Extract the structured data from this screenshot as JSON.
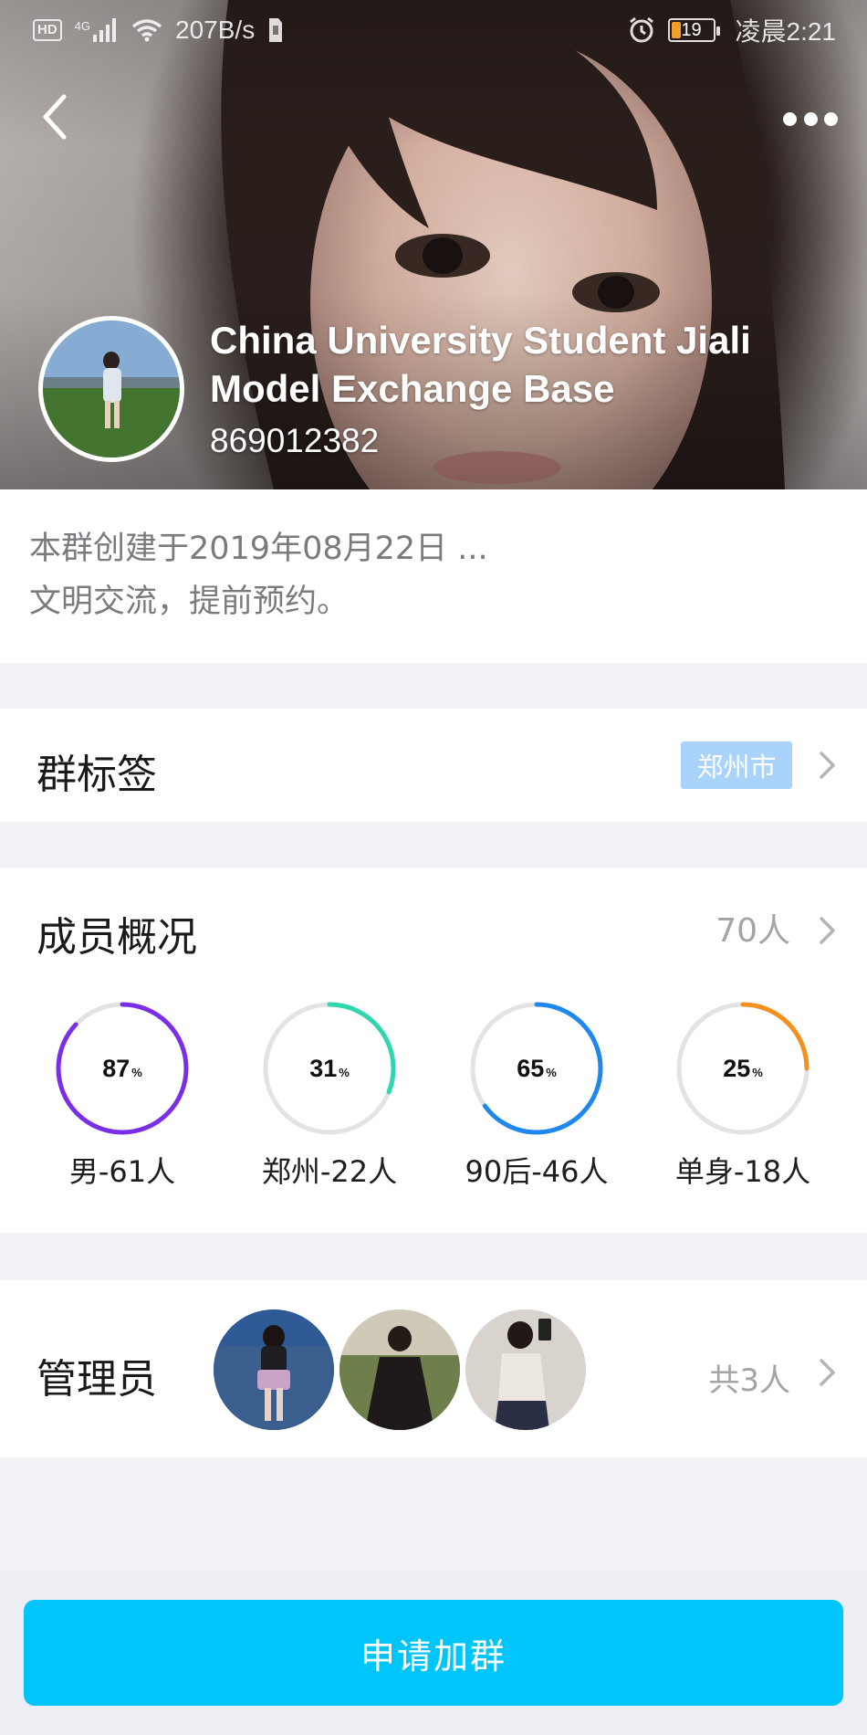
{
  "status_bar": {
    "network_badge": "HD",
    "network_type": "4G",
    "speed": "207B/s",
    "battery_level": "19",
    "time": "凌晨2:21",
    "battery_color": "#f3a02b"
  },
  "header": {
    "back_icon": "chevron-left-icon",
    "more_icon": "more-dots-icon"
  },
  "group": {
    "name": "China University Student Jiali Model Exchange Base",
    "id": "869012382"
  },
  "description": {
    "line1": "本群创建于2019年08月22日 ...",
    "line2": "文明交流，提前预约。"
  },
  "tags": {
    "title": "群标签",
    "city_tag": "郑州市",
    "tag_color": "#a9d3fb"
  },
  "members": {
    "title": "成员概况",
    "count": "70人",
    "stats": [
      {
        "value": "87",
        "unit": "%",
        "percent": 87,
        "color": "#7a2ee8",
        "label": "男-61人"
      },
      {
        "value": "31",
        "unit": "%",
        "percent": 31,
        "color": "#2fd6b0",
        "label": "郑州-22人"
      },
      {
        "value": "65",
        "unit": "%",
        "percent": 65,
        "color": "#1e88f0",
        "label": "90后-46人"
      },
      {
        "value": "25",
        "unit": "%",
        "percent": 25,
        "color": "#f5901f",
        "label": "单身-18人"
      }
    ]
  },
  "admins": {
    "title": "管理员",
    "count": "共3人"
  },
  "join_button": {
    "label": "申请加群",
    "color": "#00c5fb"
  }
}
